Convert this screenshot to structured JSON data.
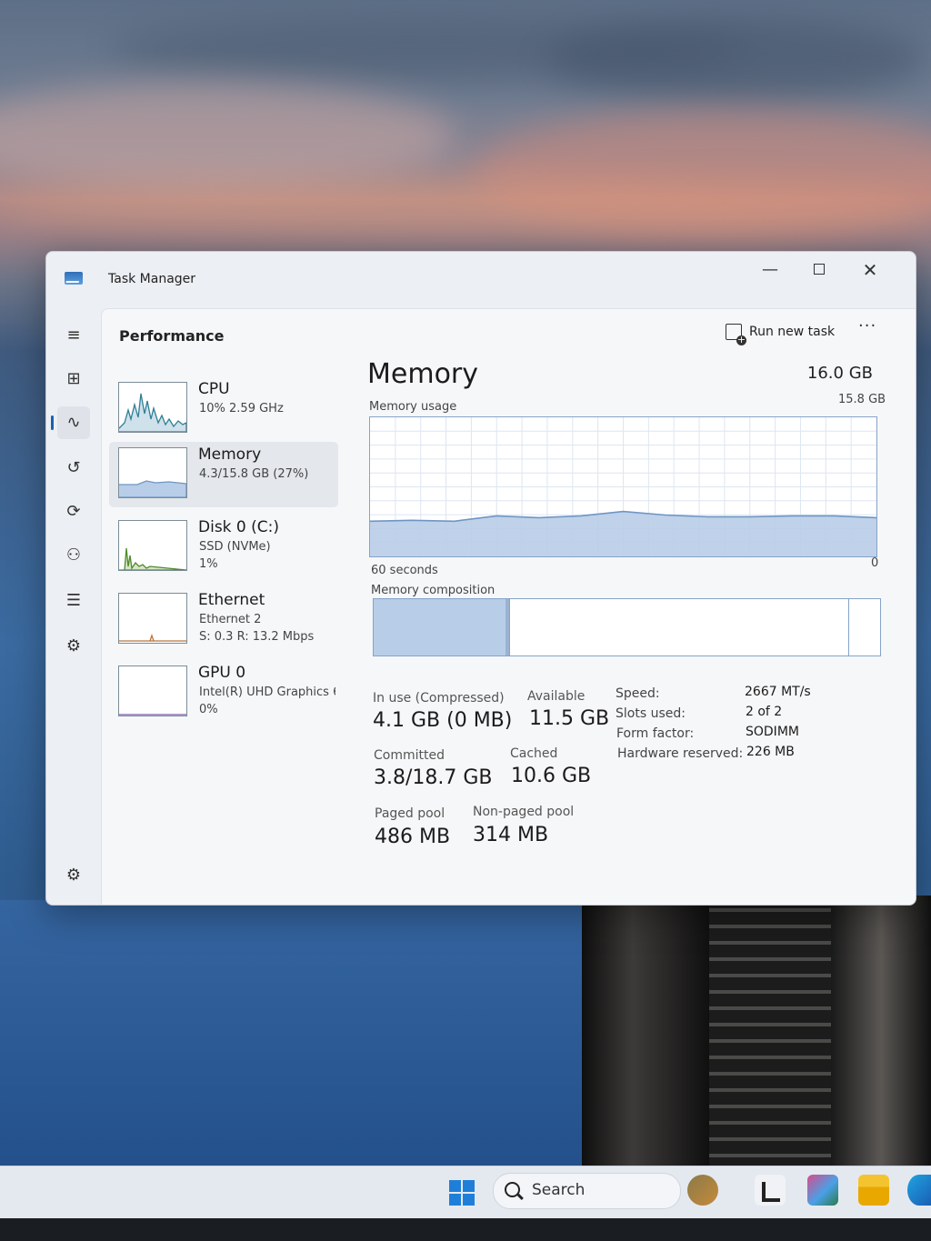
{
  "window": {
    "title": "Task Manager",
    "minimize_glyph": "—",
    "close_glyph": "✕"
  },
  "nav": {
    "items": [
      {
        "name": "menu-icon",
        "glyph": "≡"
      },
      {
        "name": "processes-icon",
        "glyph": "⊞"
      },
      {
        "name": "performance-icon",
        "glyph": "∿",
        "active": true
      },
      {
        "name": "app-history-icon",
        "glyph": "↺"
      },
      {
        "name": "startup-apps-icon",
        "glyph": "⟳"
      },
      {
        "name": "users-icon",
        "glyph": "⚇"
      },
      {
        "name": "details-icon",
        "glyph": "☰"
      },
      {
        "name": "services-icon",
        "glyph": "⚙"
      }
    ],
    "settings_glyph": "⚙"
  },
  "header": {
    "page_title": "Performance",
    "run_new_task": "Run new task",
    "more": "···"
  },
  "resources": [
    {
      "name": "CPU",
      "line1": "10% 2.59 GHz",
      "line2": ""
    },
    {
      "name": "Memory",
      "line1": "4.3/15.8 GB (27%)",
      "line2": "",
      "selected": true
    },
    {
      "name": "Disk 0 (C:)",
      "line1": "SSD (NVMe)",
      "line2": "1%"
    },
    {
      "name": "Ethernet",
      "line1": "Ethernet 2",
      "line2": "S: 0.3  R: 13.2 Mbps"
    },
    {
      "name": "GPU 0",
      "line1": "Intel(R) UHD Graphics 6:",
      "line2": "0%"
    }
  ],
  "memory": {
    "title": "Memory",
    "total": "16.0 GB",
    "usage_label": "Memory usage",
    "usage_max": "15.8 GB",
    "time_span": "60 seconds",
    "axis_min": "0",
    "composition_label": "Memory composition",
    "composition": {
      "in_use": 4.1,
      "modified": 0.1,
      "standby": 10.6,
      "free": 0.9,
      "total": 15.8
    },
    "stats": {
      "in_use_label": "In use (Compressed)",
      "in_use_value": "4.1 GB (0 MB)",
      "available_label": "Available",
      "available_value": "11.5 GB",
      "committed_label": "Committed",
      "committed_value": "3.8/18.7 GB",
      "cached_label": "Cached",
      "cached_value": "10.6 GB",
      "paged_label": "Paged pool",
      "paged_value": "486 MB",
      "nonpaged_label": "Non-paged pool",
      "nonpaged_value": "314 MB"
    },
    "specs": {
      "speed_label": "Speed:",
      "speed_value": "2667 MT/s",
      "slots_label": "Slots used:",
      "slots_value": "2 of 2",
      "form_label": "Form factor:",
      "form_value": "SODIMM",
      "reserved_label": "Hardware reserved:",
      "reserved_value": "226 MB"
    }
  },
  "chart_data": {
    "type": "area",
    "title": "Memory usage",
    "x": [
      60,
      55,
      50,
      45,
      40,
      35,
      30,
      25,
      20,
      15,
      10,
      5,
      0
    ],
    "values": [
      4.0,
      4.1,
      4.0,
      4.6,
      4.4,
      4.6,
      5.1,
      4.7,
      4.5,
      4.5,
      4.6,
      4.6,
      4.4
    ],
    "xlabel": "60 seconds",
    "ylim": [
      0,
      15.8
    ],
    "grid": true
  },
  "taskbar": {
    "search_label": "Search"
  },
  "colors": {
    "accent": "#1a5fb4",
    "memory_fill": "#b8cde8",
    "memory_line": "#6f95c4"
  }
}
